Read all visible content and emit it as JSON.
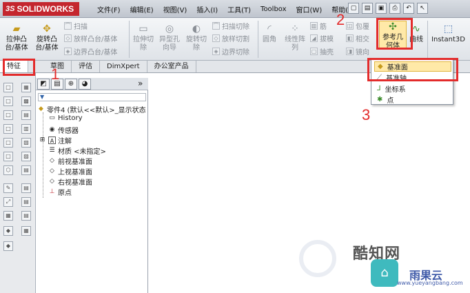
{
  "app": {
    "logo_text": "SOLIDWORKS",
    "logo_mark": "3S"
  },
  "menu": [
    "文件(F)",
    "编辑(E)",
    "视图(V)",
    "插入(I)",
    "工具(T)",
    "Toolbox",
    "窗口(W)",
    "帮助(H)"
  ],
  "ribbon": {
    "extrude_boss": "拉伸凸\n台/基体",
    "revolve_boss": "旋转凸\n台/基体",
    "sweep": "扫描",
    "loft": "放样凸台/基体",
    "boundary_boss": "边界凸台/基体",
    "extrude_cut": "拉伸切\n除",
    "hole_wizard": "异型孔\n向导",
    "revolve_cut": "旋转切\n除",
    "sweep_cut": "扫描切除",
    "loft_cut": "放样切割",
    "boundary_cut": "边界切除",
    "fillet": "圆角",
    "linear_pattern": "线性阵\n列",
    "rib": "筋",
    "draft": "拔模",
    "shell": "抽壳",
    "wrap": "包覆",
    "intersect": "相交",
    "mirror": "镜向",
    "ref_geometry": "参考几\n何体",
    "curves": "曲线",
    "instant3d": "Instant3D"
  },
  "tabs": [
    "特征",
    "草图",
    "评估",
    "DimXpert",
    "办公室产品"
  ],
  "tree": {
    "root": "零件4 (默认<<默认>_显示状态",
    "items": [
      "History",
      "传感器",
      "注解",
      "材质 <未指定>",
      "前视基准面",
      "上视基准面",
      "右视基准面",
      "原点"
    ]
  },
  "dropdown": [
    "基准面",
    "基准轴",
    "坐标系",
    "点"
  ],
  "annotations": [
    "1",
    "2",
    "3"
  ],
  "watermark": {
    "brand": "酷知网",
    "site_name": "雨果云",
    "url": "www.yueyangbang.com"
  }
}
